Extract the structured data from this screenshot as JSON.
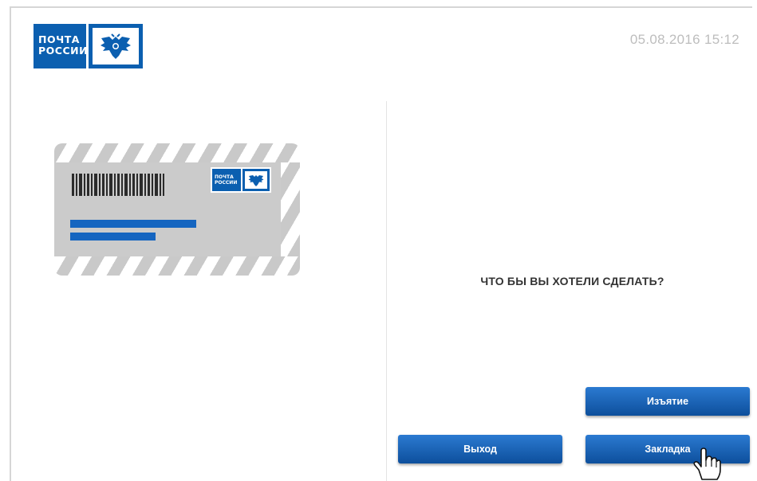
{
  "header": {
    "logo_line1": "ПОЧТА",
    "logo_line2": "РОССИИ",
    "datetime": "05.08.2016  15:12"
  },
  "envelope": {
    "stamp_line1": "ПОЧТА",
    "stamp_line2": "РОССИИ",
    "stripe_color": "#c9c9c9",
    "address_color": "#1565c0"
  },
  "main": {
    "question": "ЧТО БЫ ВЫ ХОТЕЛИ СДЕЛАТЬ?"
  },
  "buttons": {
    "withdraw": "Изъятие",
    "exit": "Выход",
    "bookmark": "Закладка"
  },
  "colors": {
    "brand_blue": "#0b5fb0",
    "button_top": "#2b7ad1",
    "button_bottom": "#0d4f9c"
  },
  "icons": [
    "russian-post-emblem-icon",
    "barcode-icon",
    "hand-pointer-icon"
  ]
}
